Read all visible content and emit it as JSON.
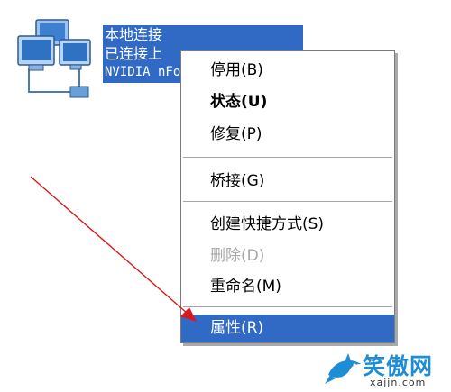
{
  "desktop_icon": {
    "label_lines": [
      "本地连接",
      "已连接上",
      "NVIDIA nForce"
    ]
  },
  "context_menu": {
    "items": [
      {
        "label": "停用(B)",
        "style": "normal"
      },
      {
        "label": "状态(U)",
        "style": "bold"
      },
      {
        "label": "修复(P)",
        "style": "normal"
      },
      {
        "label": "桥接(G)",
        "style": "normal"
      },
      {
        "label": "创建快捷方式(S)",
        "style": "normal"
      },
      {
        "label": "删除(D)",
        "style": "disabled"
      },
      {
        "label": "重命名(M)",
        "style": "normal"
      },
      {
        "label": "属性(R)",
        "style": "selected"
      }
    ]
  },
  "colors": {
    "selection": "#316ac5",
    "arrow": "#d7191c",
    "disabled_text": "#a8a8a8"
  },
  "watermark": {
    "logo": "笑傲网",
    "url": "xajjn.com"
  }
}
